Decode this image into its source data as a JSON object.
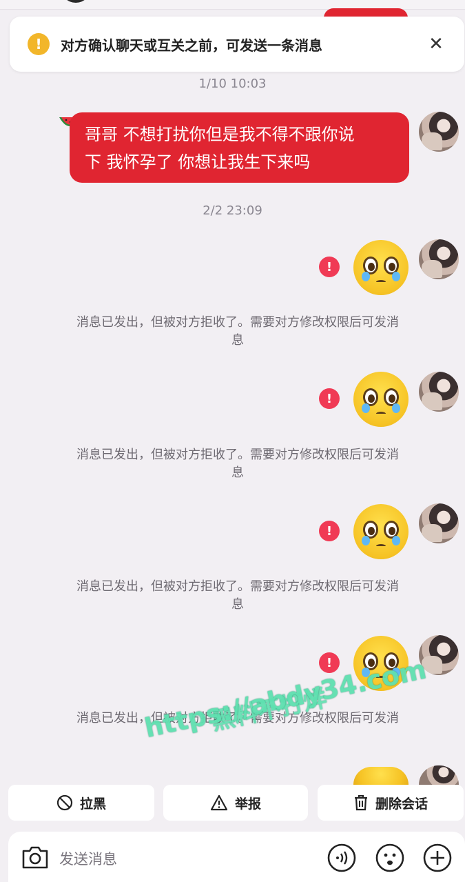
{
  "notice": {
    "text": "对方确认聊天或互关之前，可发送一条消息",
    "warning_icon": "!",
    "close_icon": "✕"
  },
  "messages": {
    "timestamp_1": "1/10 10:03",
    "first_message": [
      "哥哥 不想打扰你但是我不得不跟你说",
      "下 我怀孕了 你想让我生下来吗"
    ],
    "timestamp_2": "2/2 23:09",
    "error_mark": "!",
    "rejected_text": [
      "消息已发出，但被对方拒收了。需要对方修改权限后可发消",
      "息"
    ]
  },
  "watermark": {
    "title": "黑料不打烊",
    "url": "https://abdy34.com"
  },
  "actions": {
    "block": "拉黑",
    "report": "举报",
    "delete": "删除会话"
  },
  "input": {
    "placeholder": "发送消息"
  },
  "colors": {
    "bubble": "#e02531",
    "error": "#f03a55",
    "warning": "#f2b62a",
    "background": "#f2eff3"
  }
}
